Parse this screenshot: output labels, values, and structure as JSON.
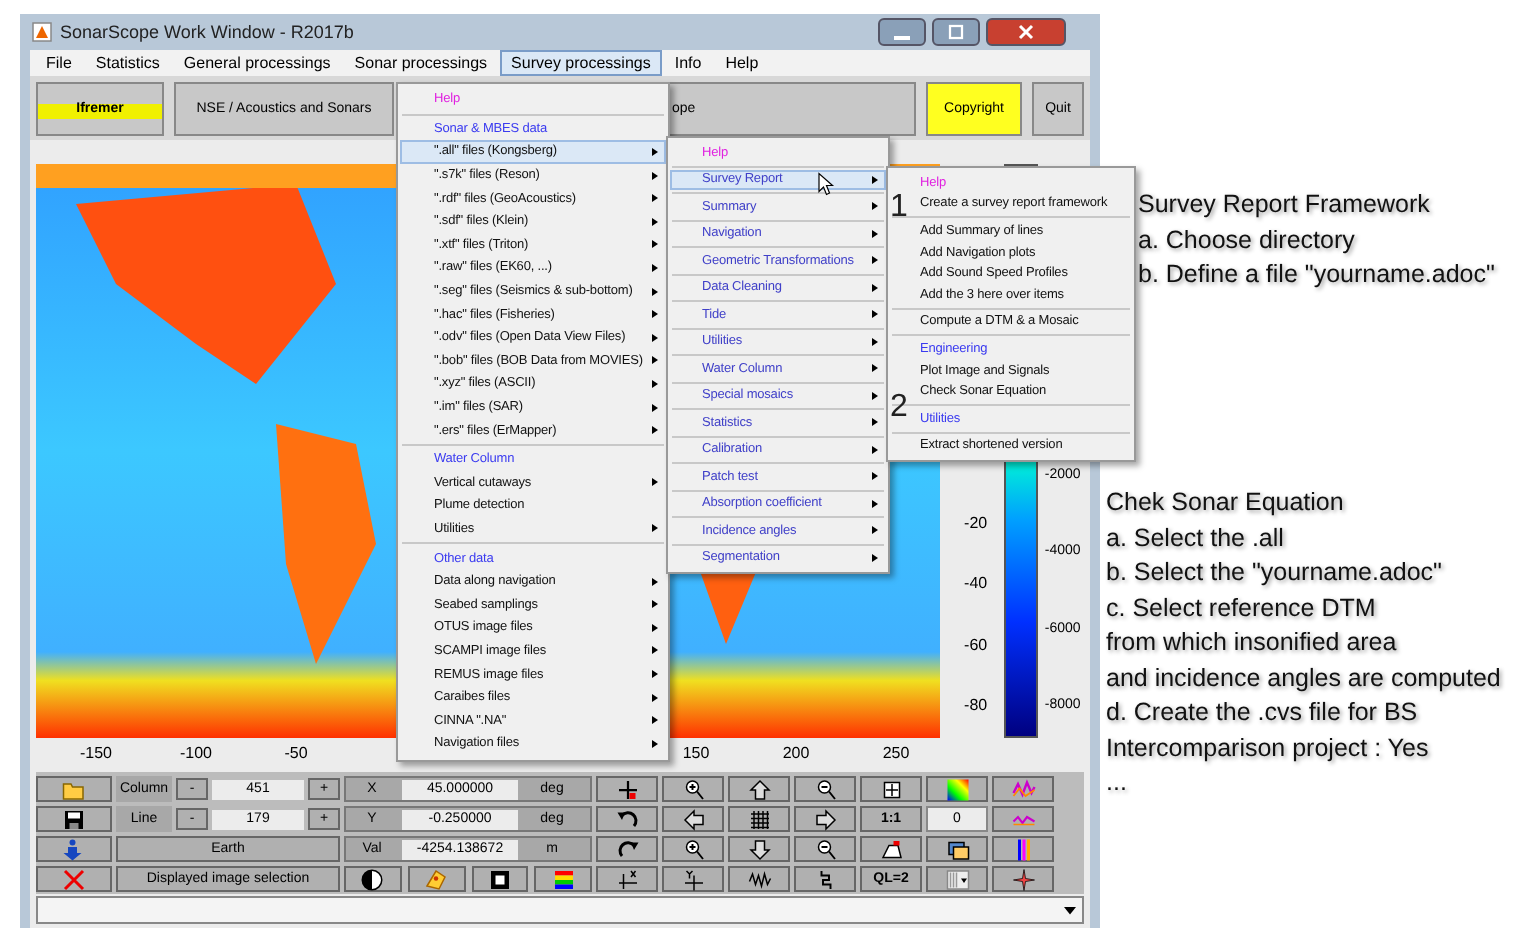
{
  "window": {
    "title": "SonarScope Work Window - R2017b"
  },
  "menu_bar": [
    {
      "label": "File",
      "selected": false
    },
    {
      "label": "Statistics",
      "selected": false
    },
    {
      "label": "General processings",
      "selected": false
    },
    {
      "label": "Sonar processings",
      "selected": false
    },
    {
      "label": "Survey processings",
      "selected": true
    },
    {
      "label": "Info",
      "selected": false
    },
    {
      "label": "Help",
      "selected": false
    }
  ],
  "toolbar": {
    "logo_text": "Ifremer",
    "buttons": [
      {
        "kind": "plain",
        "label": "NSE / Acoustics and Sonars"
      },
      {
        "kind": "covered",
        "label": "ope"
      },
      {
        "kind": "highlight",
        "label": "Copyright"
      },
      {
        "kind": "plain",
        "label": "Quit"
      }
    ]
  },
  "plot": {
    "x_ticks": [
      "-150",
      "-100",
      "-50",
      "150",
      "200",
      "250"
    ],
    "y_ticks": [
      "-20",
      "-40",
      "-60",
      "-80"
    ],
    "colorbar_ticks": [
      "-2000",
      "-4000",
      "-6000",
      "-8000"
    ]
  },
  "controls": {
    "column": {
      "label": "Column",
      "decrement": "-",
      "value": "451",
      "increment": "+"
    },
    "line": {
      "label": "Line",
      "decrement": "-",
      "value": "179",
      "increment": "+"
    },
    "earth_button": "Earth",
    "selection_button": "Displayed image selection",
    "coordinates": [
      {
        "label": "X",
        "value": "45.000000",
        "unit": "deg"
      },
      {
        "label": "Y",
        "value": "-0.250000",
        "unit": "deg"
      },
      {
        "label": "Val",
        "value": "-4254.138672",
        "unit": "m"
      }
    ],
    "tool_grid": [
      [
        {
          "kind": "icon"
        },
        {
          "kind": "icon"
        },
        {
          "kind": "icon"
        },
        {
          "kind": "icon"
        },
        {
          "kind": "icon"
        },
        {
          "kind": "icon"
        },
        {
          "kind": "icon"
        }
      ],
      [
        {
          "kind": "icon"
        },
        {
          "kind": "icon"
        },
        {
          "kind": "icon"
        },
        {
          "kind": "icon"
        },
        {
          "kind": "text",
          "label": "1:1"
        },
        {
          "kind": "field",
          "value": "0"
        },
        {
          "kind": "icon"
        }
      ],
      [
        {
          "kind": "icon"
        },
        {
          "kind": "icon"
        },
        {
          "kind": "icon"
        },
        {
          "kind": "icon"
        },
        {
          "kind": "icon"
        },
        {
          "kind": "icon"
        },
        {
          "kind": "icon"
        }
      ],
      [
        {
          "kind": "icon"
        },
        {
          "kind": "icon"
        },
        {
          "kind": "icon"
        },
        {
          "kind": "icon"
        },
        {
          "kind": "text",
          "label": "QL=2"
        },
        {
          "kind": "icon"
        },
        {
          "kind": "icon"
        }
      ]
    ]
  },
  "menus": [
    {
      "sections": [
        [
          {
            "label": "Help",
            "kind": "help",
            "submenu": false,
            "selected": false
          }
        ],
        [
          {
            "label": "Sonar & MBES data",
            "kind": "heading",
            "submenu": false,
            "selected": false
          },
          {
            "label": "\".all\" files (Kongsberg)",
            "kind": "entry",
            "submenu": true,
            "selected": true
          },
          {
            "label": "\".s7k\" files (Reson)",
            "kind": "entry",
            "submenu": true,
            "selected": false
          },
          {
            "label": "\".rdf\" files (GeoAcoustics)",
            "kind": "entry",
            "submenu": true,
            "selected": false
          },
          {
            "label": "\".sdf\" files (Klein)",
            "kind": "entry",
            "submenu": true,
            "selected": false
          },
          {
            "label": "\".xtf\" files (Triton)",
            "kind": "entry",
            "submenu": true,
            "selected": false
          },
          {
            "label": "\".raw\" files (EK60, ...)",
            "kind": "entry",
            "submenu": true,
            "selected": false
          },
          {
            "label": "\".seg\" files (Seismics & sub-bottom)",
            "kind": "entry",
            "submenu": true,
            "selected": false
          },
          {
            "label": "\".hac\" files (Fisheries)",
            "kind": "entry",
            "submenu": true,
            "selected": false
          },
          {
            "label": "\".odv\" files (Open Data View Files)",
            "kind": "entry",
            "submenu": true,
            "selected": false
          },
          {
            "label": "\".bob\" files (BOB Data from MOVIES)",
            "kind": "entry",
            "submenu": true,
            "selected": false
          },
          {
            "label": "\".xyz\" files (ASCII)",
            "kind": "entry",
            "submenu": true,
            "selected": false
          },
          {
            "label": "\".im\" files (SAR)",
            "kind": "entry",
            "submenu": true,
            "selected": false
          },
          {
            "label": "\".ers\" files (ErMapper)",
            "kind": "entry",
            "submenu": true,
            "selected": false
          }
        ],
        [
          {
            "label": "Water Column",
            "kind": "heading",
            "submenu": false,
            "selected": false
          },
          {
            "label": "Vertical cutaways",
            "kind": "entry",
            "submenu": true,
            "selected": false
          },
          {
            "label": "Plume detection",
            "kind": "entry",
            "submenu": false,
            "selected": false
          },
          {
            "label": "Utilities",
            "kind": "entry",
            "submenu": true,
            "selected": false
          }
        ],
        [
          {
            "label": "Other data",
            "kind": "heading",
            "submenu": false,
            "selected": false
          },
          {
            "label": "Data along navigation",
            "kind": "entry",
            "submenu": true,
            "selected": false
          },
          {
            "label": "Seabed samplings",
            "kind": "entry",
            "submenu": true,
            "selected": false
          },
          {
            "label": "OTUS image files",
            "kind": "entry",
            "submenu": true,
            "selected": false
          },
          {
            "label": "SCAMPI image files",
            "kind": "entry",
            "submenu": true,
            "selected": false
          },
          {
            "label": "REMUS image files",
            "kind": "entry",
            "submenu": true,
            "selected": false
          },
          {
            "label": "Caraibes files",
            "kind": "entry",
            "submenu": true,
            "selected": false
          },
          {
            "label": "CINNA \".NA\"",
            "kind": "entry",
            "submenu": true,
            "selected": false
          },
          {
            "label": "Navigation files",
            "kind": "entry",
            "submenu": true,
            "selected": false
          }
        ]
      ]
    },
    {
      "sections": [
        [
          {
            "label": "Help",
            "kind": "help",
            "submenu": false,
            "selected": false
          }
        ],
        [
          {
            "label": "Survey Report",
            "kind": "group",
            "submenu": true,
            "selected": true
          }
        ],
        [
          {
            "label": "Summary",
            "kind": "group",
            "submenu": true,
            "selected": false
          }
        ],
        [
          {
            "label": "Navigation",
            "kind": "group",
            "submenu": true,
            "selected": false
          }
        ],
        [
          {
            "label": "Geometric Transformations",
            "kind": "group",
            "submenu": true,
            "selected": false
          }
        ],
        [
          {
            "label": "Data Cleaning",
            "kind": "group",
            "submenu": true,
            "selected": false
          }
        ],
        [
          {
            "label": "Tide",
            "kind": "group",
            "submenu": true,
            "selected": false
          }
        ],
        [
          {
            "label": "Utilities",
            "kind": "group",
            "submenu": true,
            "selected": false
          }
        ],
        [
          {
            "label": "Water Column",
            "kind": "group",
            "submenu": true,
            "selected": false
          }
        ],
        [
          {
            "label": "Special mosaics",
            "kind": "group",
            "submenu": true,
            "selected": false
          }
        ],
        [
          {
            "label": "Statistics",
            "kind": "group",
            "submenu": true,
            "selected": false
          }
        ],
        [
          {
            "label": "Calibration",
            "kind": "group",
            "submenu": true,
            "selected": false
          }
        ],
        [
          {
            "label": "Patch test",
            "kind": "group",
            "submenu": true,
            "selected": false
          }
        ],
        [
          {
            "label": "Absorption coefficient",
            "kind": "group",
            "submenu": true,
            "selected": false
          }
        ],
        [
          {
            "label": "Incidence angles",
            "kind": "group",
            "submenu": true,
            "selected": false
          }
        ],
        [
          {
            "label": "Segmentation",
            "kind": "group",
            "submenu": true,
            "selected": false
          }
        ]
      ]
    },
    {
      "sections": [
        [
          {
            "label": "Help",
            "kind": "help",
            "submenu": false,
            "selected": false
          },
          {
            "label": "Create a survey report framework",
            "kind": "entry",
            "submenu": false,
            "selected": false
          }
        ],
        [
          {
            "label": "Add Summary of lines",
            "kind": "entry",
            "submenu": false,
            "selected": false
          },
          {
            "label": "Add Navigation plots",
            "kind": "entry",
            "submenu": false,
            "selected": false
          },
          {
            "label": "Add Sound Speed Profiles",
            "kind": "entry",
            "submenu": false,
            "selected": false
          },
          {
            "label": "Add the 3 here over items",
            "kind": "entry",
            "submenu": false,
            "selected": false
          }
        ],
        [
          {
            "label": "Compute a DTM & a Mosaic",
            "kind": "entry",
            "submenu": false,
            "selected": false
          }
        ],
        [
          {
            "label": "Engineering",
            "kind": "heading",
            "submenu": false,
            "selected": false
          },
          {
            "label": "Plot Image and Signals",
            "kind": "entry",
            "submenu": false,
            "selected": false
          },
          {
            "label": "Check Sonar Equation",
            "kind": "entry",
            "submenu": false,
            "selected": false
          }
        ],
        [
          {
            "label": "Utilities",
            "kind": "heading",
            "submenu": false,
            "selected": false
          }
        ],
        [
          {
            "label": "Extract shortened version",
            "kind": "entry",
            "submenu": false,
            "selected": false
          }
        ]
      ]
    }
  ],
  "step_markers": [
    "1",
    "2"
  ],
  "notes": [
    {
      "lines": [
        "Survey Report Framework",
        "a. Choose directory",
        "b. Define a file \"yourname.adoc\""
      ]
    },
    {
      "lines": [
        "Chek Sonar Equation",
        "a. Select the .all",
        "b. Select the \"yourname.adoc\"",
        "c. Select reference DTM",
        "from which insonified area",
        "and incidence angles are computed",
        "d. Create the .cvs file for BS",
        "Intercomparison project : Yes",
        "..."
      ]
    }
  ]
}
